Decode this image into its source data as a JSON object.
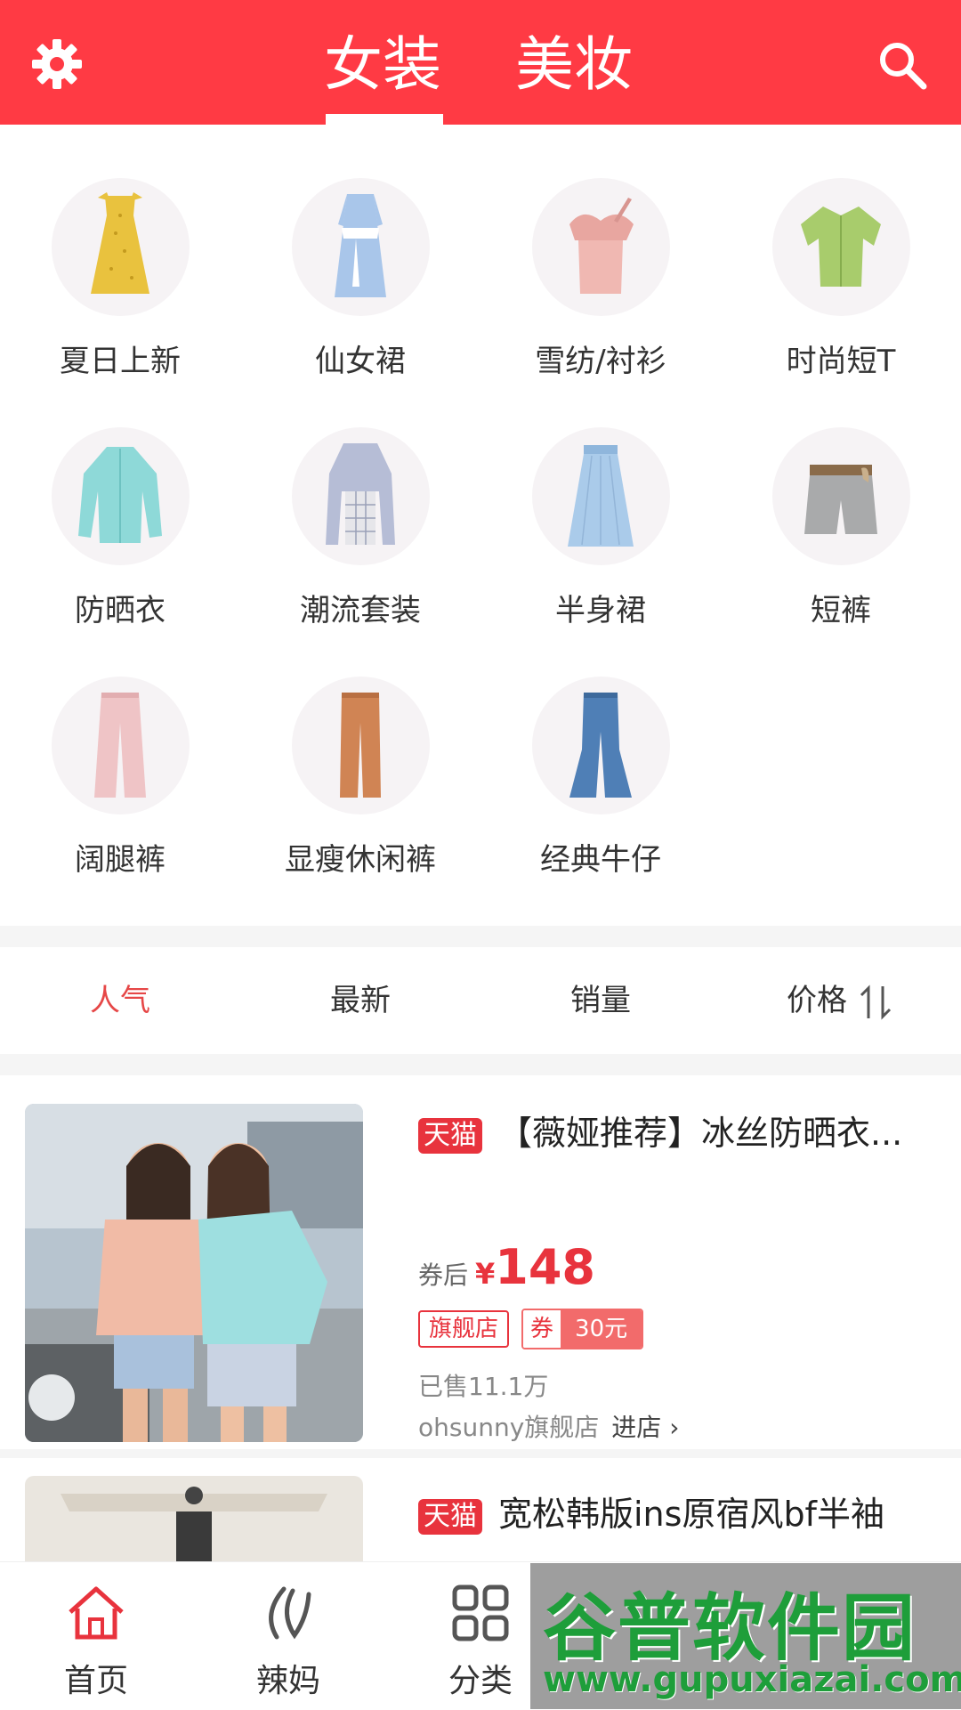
{
  "header": {
    "tabs": [
      {
        "label": "女装",
        "active": true
      },
      {
        "label": "美妆",
        "active": false
      }
    ],
    "settings_icon": "gear-icon",
    "search_icon": "search-icon",
    "brand_color": "#ff3a44"
  },
  "categories": [
    {
      "label": "夏日上新",
      "icon": "yellow-dress"
    },
    {
      "label": "仙女裙",
      "icon": "blue-dress"
    },
    {
      "label": "雪纺/衬衫",
      "icon": "pink-ruffle-top"
    },
    {
      "label": "时尚短T",
      "icon": "green-blouse"
    },
    {
      "label": "防晒衣",
      "icon": "aqua-shirt"
    },
    {
      "label": "潮流套装",
      "icon": "plaid-set"
    },
    {
      "label": "半身裙",
      "icon": "tulle-skirt"
    },
    {
      "label": "短裤",
      "icon": "grey-shorts"
    },
    {
      "label": "阔腿裤",
      "icon": "pink-pants"
    },
    {
      "label": "显瘦休闲裤",
      "icon": "orange-pants"
    },
    {
      "label": "经典牛仔",
      "icon": "flare-jeans"
    }
  ],
  "sort_bar": {
    "items": [
      {
        "label": "人气",
        "active": true
      },
      {
        "label": "最新",
        "active": false
      },
      {
        "label": "销量",
        "active": false
      },
      {
        "label": "价格",
        "active": false
      }
    ],
    "active_color": "#e64747"
  },
  "products": [
    {
      "platform": "天猫",
      "title": "【薇娅推荐】冰丝防晒衣...",
      "price_prefix": "券后",
      "currency": "¥",
      "price": "148",
      "store_badge": "旗舰店",
      "coupon_label": "券",
      "coupon_value": "30元",
      "sold": "已售11.1万",
      "shop": "ohsunny旗舰店",
      "enter_shop": "进店"
    },
    {
      "platform": "天猫",
      "title": "宽松韩版ins原宿风bf半袖"
    }
  ],
  "bottom_nav": [
    {
      "label": "首页",
      "icon": "home-icon",
      "active": true
    },
    {
      "label": "辣妈",
      "icon": "mom-icon",
      "active": false
    },
    {
      "label": "分类",
      "icon": "grid-icon",
      "active": false
    }
  ],
  "watermark": {
    "line1": "谷普软件园",
    "line2": "www.gupuxiazai.com"
  }
}
